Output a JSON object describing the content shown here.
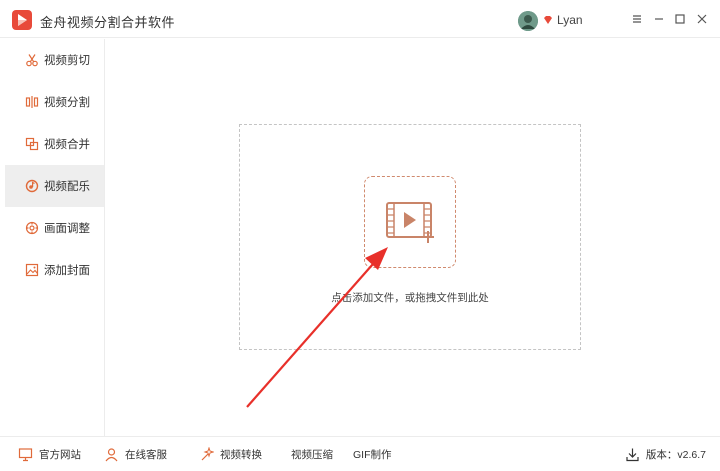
{
  "app": {
    "title": "金舟视频分割合并软件"
  },
  "user": {
    "name": "Lyan"
  },
  "sidebar": {
    "items": [
      {
        "label": "视频剪切",
        "icon": "scissors-icon"
      },
      {
        "label": "视频分割",
        "icon": "split-icon"
      },
      {
        "label": "视频合并",
        "icon": "merge-icon"
      },
      {
        "label": "视频配乐",
        "icon": "music-icon",
        "active": true
      },
      {
        "label": "画面调整",
        "icon": "adjust-icon"
      },
      {
        "label": "添加封面",
        "icon": "image-icon"
      }
    ]
  },
  "main": {
    "drop_hint": "点击添加文件，或拖拽文件到此处"
  },
  "footer": {
    "official_site": "官方网站",
    "online_service": "在线客服",
    "video_convert": "视频转换",
    "video_compress": "视频压缩",
    "gif_make": "GIF制作",
    "version": "版本：v2.6.7"
  },
  "colors": {
    "accent": "#e06a3a",
    "logo_red": "#e84a3a",
    "arrow_red": "#e8302a",
    "add_box_border": "#d08a6e"
  }
}
